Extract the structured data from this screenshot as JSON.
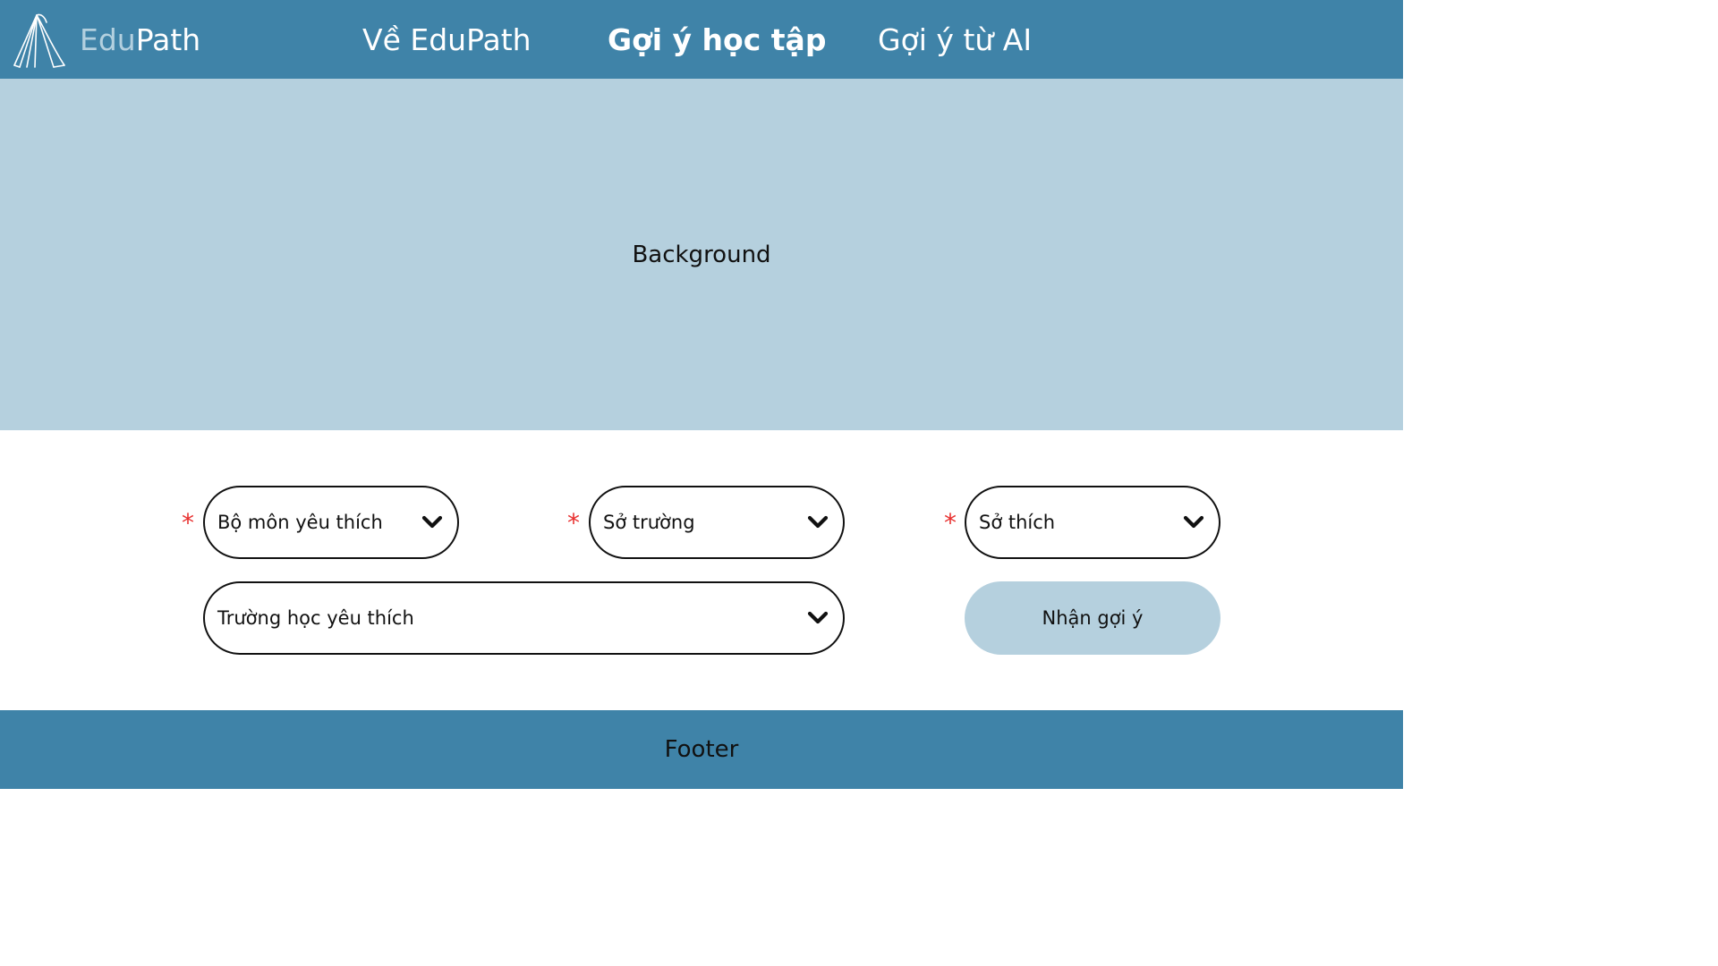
{
  "brand": {
    "name_part1": "Edu",
    "name_part2": "Path",
    "logo_icon": "book-fan-icon",
    "accent_color": "#3f83a8",
    "light_color": "#b5d0de"
  },
  "nav": {
    "items": [
      {
        "label": "Về EduPath",
        "active": false
      },
      {
        "label": "Gợi ý học tập",
        "active": true
      },
      {
        "label": "Gợi ý từ AI",
        "active": false
      }
    ]
  },
  "hero": {
    "label": "Background"
  },
  "form": {
    "required_mark": "*",
    "required_color": "#e8302f",
    "fields": [
      {
        "label": "Bộ môn yêu thích",
        "required": true,
        "icon": "chevron-down-icon"
      },
      {
        "label": "Sở trường",
        "required": true,
        "icon": "chevron-down-icon"
      },
      {
        "label": "Sở thích",
        "required": true,
        "icon": "chevron-down-icon"
      },
      {
        "label": "Trường học yêu thích",
        "required": false,
        "icon": "chevron-down-icon"
      }
    ],
    "submit_label": "Nhận gợi ý"
  },
  "footer": {
    "label": "Footer"
  }
}
